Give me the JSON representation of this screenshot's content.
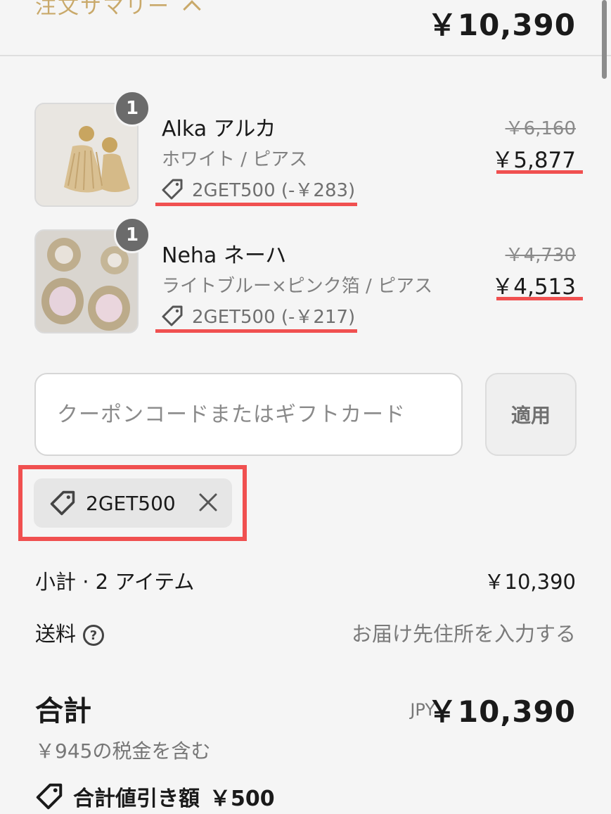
{
  "header": {
    "summary_label": "注文サマリー",
    "total": "￥10,390"
  },
  "items": [
    {
      "quantity": "1",
      "name": "Alka アルカ",
      "variant": "ホワイト / ピアス",
      "discount": "2GET500 (-￥283)",
      "original_price": "￥6,160",
      "price": "￥5,877",
      "image_icon": "earring-tassel-image"
    },
    {
      "quantity": "1",
      "name": "Neha ネーハ",
      "variant": "ライトブルー×ピンク箔 / ピアス",
      "discount": "2GET500 (-￥217)",
      "original_price": "￥4,730",
      "price": "￥4,513",
      "image_icon": "earring-jewel-image"
    }
  ],
  "coupon": {
    "placeholder": "クーポンコードまたはギフトカード",
    "value": "",
    "apply_label": "適用",
    "applied_code": "2GET500"
  },
  "summary": {
    "subtotal_label": "小計 · 2 アイテム",
    "subtotal_value": "￥10,390",
    "shipping_label": "送料",
    "shipping_value": "お届け先住所を入力する",
    "total_label": "合計",
    "currency": "JPY",
    "total_value": "￥10,390",
    "tax_note": "￥945の税金を含む",
    "savings_label": "合計値引き額",
    "savings_value": "￥500"
  },
  "colors": {
    "accent_gold": "#c9a96a",
    "highlight_red": "#f05050",
    "background": "#f5f5f5"
  }
}
